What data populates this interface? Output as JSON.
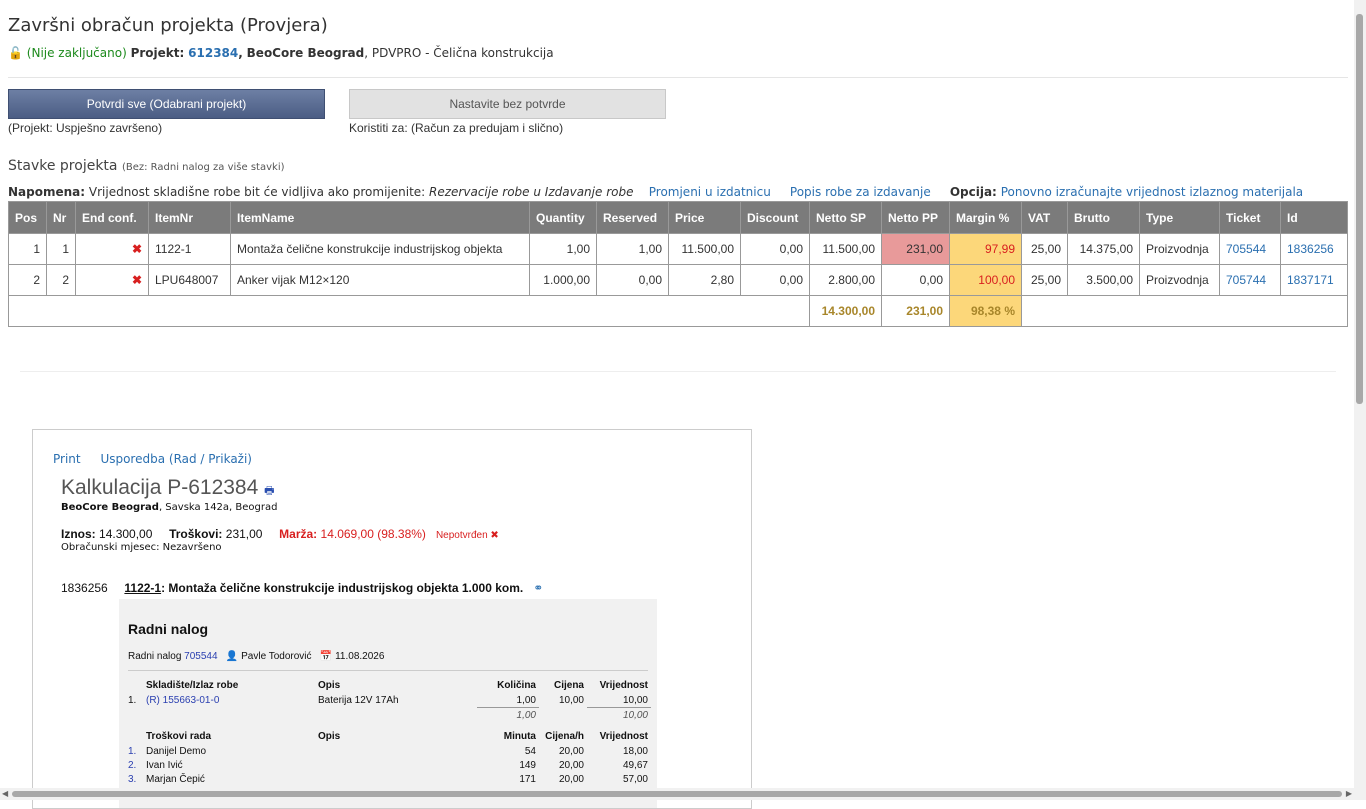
{
  "header": {
    "title": "Završni obračun projekta (Provjera)",
    "lock_status": "(Nije zaključano)",
    "project_label": "Projekt:",
    "project_id": "612384",
    "company": "BeoCore Beograd",
    "project_desc": ", PDVPRO - Čelična konstrukcija"
  },
  "actions": {
    "confirm_label": "Potvrdi sve (Odabrani projekt)",
    "confirm_note": "(Projekt: Uspješno završeno)",
    "skip_label": "Nastavite bez potvrde",
    "skip_note": "Koristiti za: (Račun za predujam i slično)"
  },
  "section": {
    "title": "Stavke projekta",
    "hint": "(Bez: Radni nalog za više stavki)"
  },
  "notes": {
    "napomena_label": "Napomena:",
    "napomena_text": "Vrijednost skladišne robe bit će vidljiva ako promijenite:",
    "napomena_italic": "Rezervacije robe u Izdavanje robe",
    "link_change": "Promjeni u izdatnicu",
    "link_list": "Popis robe za izdavanje",
    "opcija_label": "Opcija:",
    "link_recalc": "Ponovno izračunajte vrijednost izlaznog materijala"
  },
  "table": {
    "columns": [
      "Pos",
      "Nr",
      "End conf.",
      "ItemNr",
      "ItemName",
      "Quantity",
      "Reserved",
      "Price",
      "Discount",
      "Netto SP",
      "Netto PP",
      "Margin %",
      "VAT",
      "Brutto",
      "Type",
      "Ticket",
      "Id"
    ],
    "rows": [
      {
        "pos": "1",
        "nr": "1",
        "end": "✖",
        "itemnr": "1122-1",
        "itemname": "Montaža čelične konstrukcije industrijskog objekta",
        "qty": "1,00",
        "reserved": "1,00",
        "price": "11.500,00",
        "discount": "0,00",
        "netto_sp": "11.500,00",
        "netto_pp": "231,00",
        "margin": "97,99",
        "vat": "25,00",
        "brutto": "14.375,00",
        "type": "Proizvodnja",
        "ticket": "705544",
        "id": "1836256"
      },
      {
        "pos": "2",
        "nr": "2",
        "end": "✖",
        "itemnr": "LPU648007",
        "itemname": "Anker vijak M12×120",
        "qty": "1.000,00",
        "reserved": "0,00",
        "price": "2,80",
        "discount": "0,00",
        "netto_sp": "2.800,00",
        "netto_pp": "0,00",
        "margin": "100,00",
        "vat": "25,00",
        "brutto": "3.500,00",
        "type": "Proizvodnja",
        "ticket": "705744",
        "id": "1837171"
      }
    ],
    "totals": {
      "netto_sp": "14.300,00",
      "netto_pp": "231,00",
      "margin": "98,38 %"
    }
  },
  "calc": {
    "link_print": "Print",
    "link_layout": "Usporedba (Rad / Prikaži)",
    "title": "Kalkulacija P-612384",
    "printer_icon": "🖶",
    "company": "BeoCore Beograd",
    "address": ", Savska 142a, Beograd",
    "iznos_label": "Iznos:",
    "iznos": "14.300,00",
    "troskovi_label": "Troškovi:",
    "troskovi": "231,00",
    "marza_label": "Marža:",
    "marza": "14.069,00 (98.38%)",
    "status": "Nepotvrđen ✖",
    "month": "Obračunski mjesec: Nezavršeno",
    "item_id": "1836256",
    "item_nr": "1122-1",
    "item_text": ": Montaža čelične konstrukcije industrijskog objekta   1.000 kom.",
    "link_icon": "⚭"
  },
  "work_order": {
    "title": "Radni nalog",
    "label": "Radni nalog",
    "ticket": "705544",
    "person": "Pavle Todorović",
    "date": "11.08.2026",
    "goods_headers": [
      "Skladište/Izlaz robe",
      "Opis",
      "Količina",
      "Cijena",
      "Vrijednost"
    ],
    "goods": [
      {
        "n": "1.",
        "code": "(R) 155663-01-0",
        "desc": "Baterija 12V 17Ah",
        "qty": "1,00",
        "price": "10,00",
        "value": "10,00"
      }
    ],
    "goods_total_qty": "1,00",
    "goods_total_value": "10,00",
    "labor_headers": [
      "Troškovi rada",
      "Opis",
      "Minuta",
      "Cijena/h",
      "Vrijednost"
    ],
    "labor": [
      {
        "n": "1.",
        "name": "Danijel Demo",
        "min": "54",
        "rate": "20,00",
        "value": "18,00"
      },
      {
        "n": "2.",
        "name": "Ivan Ivić",
        "min": "149",
        "rate": "20,00",
        "value": "49,67"
      },
      {
        "n": "3.",
        "name": "Marjan Čepić",
        "min": "171",
        "rate": "20,00",
        "value": "57,00"
      }
    ]
  }
}
